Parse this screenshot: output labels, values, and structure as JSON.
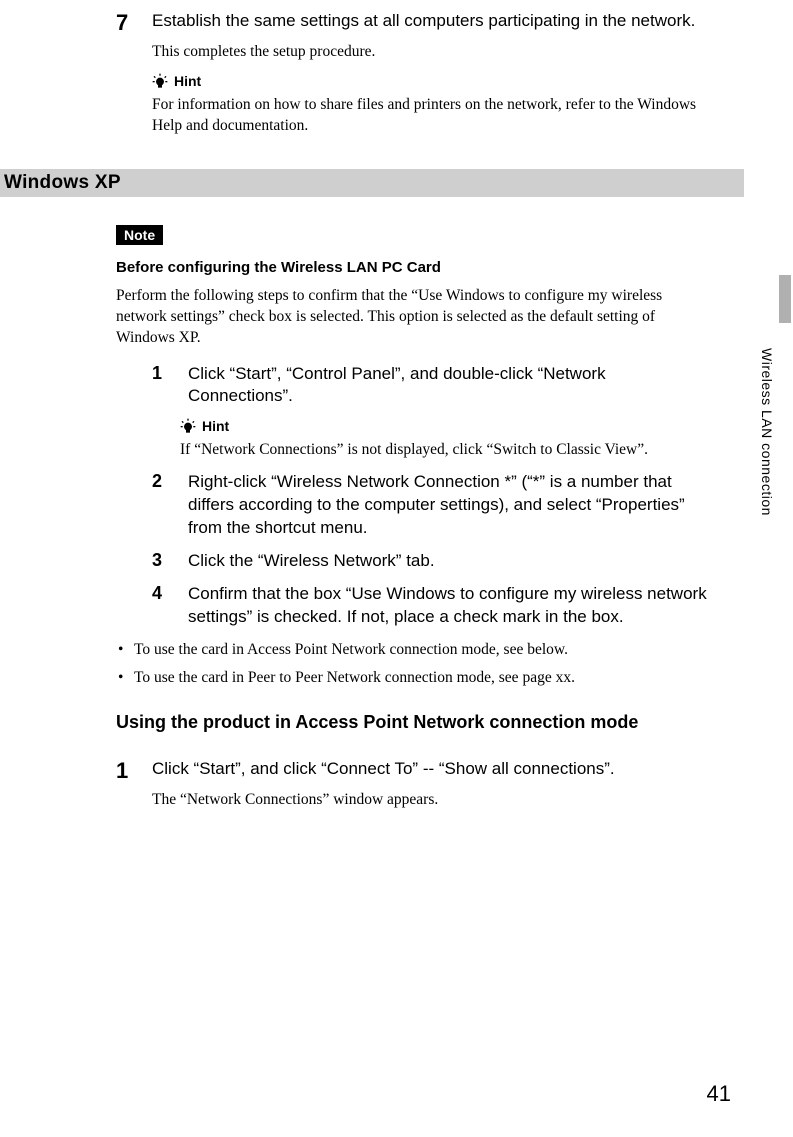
{
  "sideLabel": "Wireless LAN connection",
  "topStep": {
    "num": "7",
    "text": "Establish the same settings at all computers participating in the network.",
    "after": "This completes the setup procedure.",
    "hintLabel": "Hint",
    "hintBody": "For information on how to share files and printers on the network, refer to the Windows Help and documentation."
  },
  "sectionBar": "Windows XP",
  "noteBadge": "Note",
  "noteTitle": "Before configuring the Wireless LAN PC Card",
  "noteBody": "Perform the following steps to confirm that the “Use Windows to configure my wireless network settings” check box is selected. This option is selected as the default setting of Windows XP.",
  "steps": [
    {
      "num": "1",
      "text": "Click “Start”, “Control Panel”, and double-click “Network Connections”.",
      "hintLabel": "Hint",
      "hintBody": "If “Network Connections” is not displayed, click “Switch to Classic View”."
    },
    {
      "num": "2",
      "text": "Right-click “Wireless Network Connection *” (“*” is a number that differs according to the computer settings), and select “Properties” from the shortcut menu."
    },
    {
      "num": "3",
      "text": "Click the “Wireless Network” tab."
    },
    {
      "num": "4",
      "text": "Confirm that the box “Use Windows to configure my wireless network settings” is checked. If not, place a check mark in the box."
    }
  ],
  "bullets": [
    "To use the card in Access Point Network connection mode, see below.",
    "To use the card in Peer to Peer Network connection mode, see page xx."
  ],
  "subheading": "Using the product in Access Point Network connection mode",
  "bottomStep": {
    "num": "1",
    "text": "Click “Start”, and click “Connect To” -- “Show all connections”.",
    "after": "The “Network Connections” window appears."
  },
  "pageNumber": "41"
}
